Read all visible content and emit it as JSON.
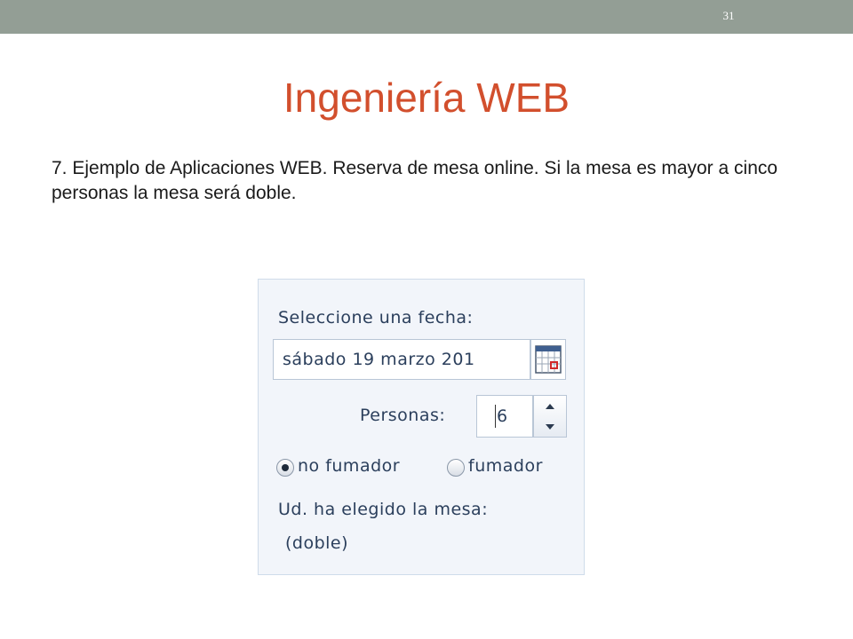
{
  "slide": {
    "number": "31",
    "title": "Ingeniería WEB",
    "body": "7.  Ejemplo de Aplicaciones WEB.  Reserva de mesa online. Si la mesa es mayor a cinco personas la mesa será doble."
  },
  "widget": {
    "date_label": "Seleccione una fecha:",
    "date_value": "sábado 19 marzo 201",
    "calendar_icon": "calendar-icon",
    "persons_label": "Personas:",
    "persons_value": "6",
    "options": [
      {
        "label": "no fumador",
        "selected": true
      },
      {
        "label": "fumador",
        "selected": false
      }
    ],
    "result_label": "Ud. ha elegido la mesa:",
    "result_value": "(doble)"
  },
  "colors": {
    "topbar": "#939e95",
    "title": "#d24f2d",
    "widget_text": "#2b3f5c"
  }
}
